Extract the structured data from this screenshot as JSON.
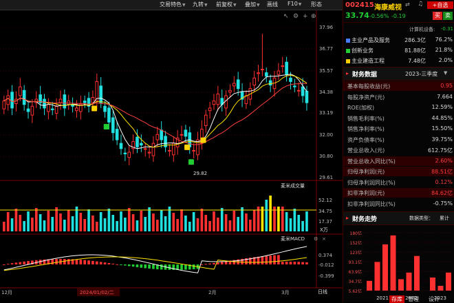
{
  "toolbar": {
    "items": [
      {
        "label": "交易特色",
        "dropdown": true
      },
      {
        "label": "九转",
        "dropdown": true
      },
      {
        "label": "前复权",
        "dropdown": true
      },
      {
        "label": "叠加",
        "dropdown": true
      },
      {
        "label": "画线",
        "dropdown": false
      },
      {
        "label": "F10",
        "dropdown": true
      },
      {
        "label": "形态",
        "dropdown": false
      }
    ]
  },
  "stock": {
    "code": "002415",
    "name": "海康威视",
    "price": "33.74",
    "change_pct": "-0.56%",
    "change": "-0.19"
  },
  "header_buttons": {
    "buy": "买",
    "sell": "卖",
    "add_watch": "+自选"
  },
  "business": {
    "header_label": "计算机设备:",
    "header_value": "-0.31",
    "rows": [
      {
        "name": "主业产品及服务",
        "amount": "286.3亿",
        "pct": "76.2%",
        "color": "#4a7cff"
      },
      {
        "name": "创新业务",
        "amount": "81.88亿",
        "pct": "21.8%",
        "color": "#22cc33"
      },
      {
        "name": "主业建造工程",
        "amount": "7.48亿",
        "pct": "2.0%",
        "color": "#ffcc00"
      }
    ]
  },
  "financial": {
    "title": "财务数据",
    "period": "2023-三季度",
    "rows": [
      {
        "label": "基本每股收益(元)",
        "value": "0.95",
        "color": "#ff3b3b",
        "selected": true
      },
      {
        "label": "每股净资产(元)",
        "value": "7.664",
        "color": "#dddddd",
        "selected": false
      },
      {
        "label": "ROE(加权)",
        "value": "12.59%",
        "color": "#dddddd",
        "selected": false
      },
      {
        "label": "销售毛利率(%)",
        "value": "44.85%",
        "color": "#dddddd",
        "selected": false
      },
      {
        "label": "销售净利率(%)",
        "value": "15.50%",
        "color": "#dddddd",
        "selected": false
      },
      {
        "label": "资产负债率(%)",
        "value": "39.75%",
        "color": "#dddddd",
        "selected": false
      },
      {
        "label": "营业总收入(元)",
        "value": "612.75亿",
        "color": "#dddddd",
        "selected": false
      },
      {
        "label": "营业总收入同比(%)",
        "value": "2.60%",
        "color": "#ff3b3b",
        "selected": true
      },
      {
        "label": "归母净利润(元)",
        "value": "88.51亿",
        "color": "#ff3b3b",
        "selected": true
      },
      {
        "label": "归母净利润同比(%)",
        "value": "0.12%",
        "color": "#ff3b3b",
        "selected": false
      },
      {
        "label": "扣非净利润(元)",
        "value": "84.62亿",
        "color": "#ff3b3b",
        "selected": true
      },
      {
        "label": "扣非净利润同比(%)",
        "value": "-0.75%",
        "color": "#dddddd",
        "selected": false
      }
    ]
  },
  "trend": {
    "title": "财务走势",
    "type_label": "数据类型：",
    "type_value": "累计",
    "y_ticks": [
      "180亿",
      "152亿",
      "123亿",
      "93.1亿",
      "63.9亿",
      "34.7亿",
      "5.62亿"
    ],
    "years": [
      "2021",
      "2022",
      "2023"
    ],
    "bar_values": [
      35,
      92,
      145,
      172,
      40,
      60,
      110,
      5,
      45,
      20,
      60
    ],
    "ylim": [
      5.62,
      180
    ]
  },
  "chart_labels": {
    "price_ticks": [
      "37.96",
      "36.77",
      "35.57",
      "34.38",
      "33.19",
      "32.00",
      "30.80",
      "29.61"
    ],
    "low_marker": "29.82",
    "volume_title": "麦米成交量",
    "volume_ticks": [
      "52.12",
      "34.75",
      "17.37"
    ],
    "volume_unit": "X万",
    "macd_title": "麦米MACD",
    "macd_ticks": [
      "0.374",
      "-0.012",
      "-0.399"
    ],
    "x_labels": [
      "12月",
      "2024/01/02/二",
      "2月",
      "3月"
    ],
    "macd_button": "日线"
  },
  "bottom_buttons": {
    "left": "存库",
    "mid": "管理",
    "right": "设计"
  },
  "colors": {
    "up": "#ff3030",
    "down": "#20e0e0",
    "ma5": "#ffffff",
    "ma10": "#ffe400",
    "ma20": "#ff4040"
  }
}
